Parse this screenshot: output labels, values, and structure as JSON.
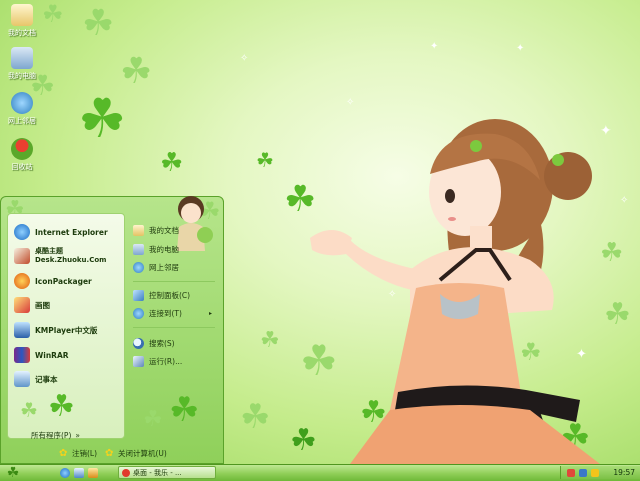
{
  "desktop_icons": [
    {
      "label": "我的文档",
      "icon": "my-documents-icon"
    },
    {
      "label": "我的电脑",
      "icon": "my-computer-icon"
    },
    {
      "label": "网上邻居",
      "icon": "network-places-icon"
    },
    {
      "label": "回收站",
      "icon": "recycle-bin-icon"
    }
  ],
  "start_menu": {
    "pinned": [
      {
        "label": "Internet Explorer",
        "icon": "internet-explorer-icon"
      },
      {
        "label": "桌酷主题",
        "label2": "Desk.Zhuoku.Com",
        "icon": "zhuoku-theme-icon"
      },
      {
        "label": "IconPackager",
        "icon": "iconpackager-icon"
      },
      {
        "label": "画图",
        "icon": "paint-icon"
      },
      {
        "label": "KMPlayer中文版",
        "icon": "kmplayer-icon"
      },
      {
        "label": "WinRAR",
        "icon": "winrar-icon"
      },
      {
        "label": "记事本",
        "icon": "notepad-icon"
      }
    ],
    "all_programs": "所有程序(P)",
    "all_programs_arrow": "»",
    "places": [
      {
        "label": "我的文档",
        "icon": "my-documents-icon"
      },
      {
        "label": "我的电脑",
        "icon": "my-computer-icon"
      },
      {
        "label": "网上邻居",
        "icon": "network-places-icon"
      },
      {
        "label": "控制面板(C)",
        "icon": "control-panel-icon"
      },
      {
        "label": "连接到(T)",
        "icon": "connect-to-icon",
        "arrow": "▸"
      },
      {
        "label": "搜索(S)",
        "icon": "search-icon"
      },
      {
        "label": "运行(R)...",
        "icon": "run-icon"
      }
    ],
    "logoff": "注销(L)",
    "shutdown": "关闭计算机(U)"
  },
  "taskbar": {
    "window_title": "桌面 - 我乐 - ...",
    "clock": "19:57"
  },
  "colors": {
    "accent": "#8fd05a",
    "clover": "#57b928",
    "taskbar": "#8fce57"
  }
}
